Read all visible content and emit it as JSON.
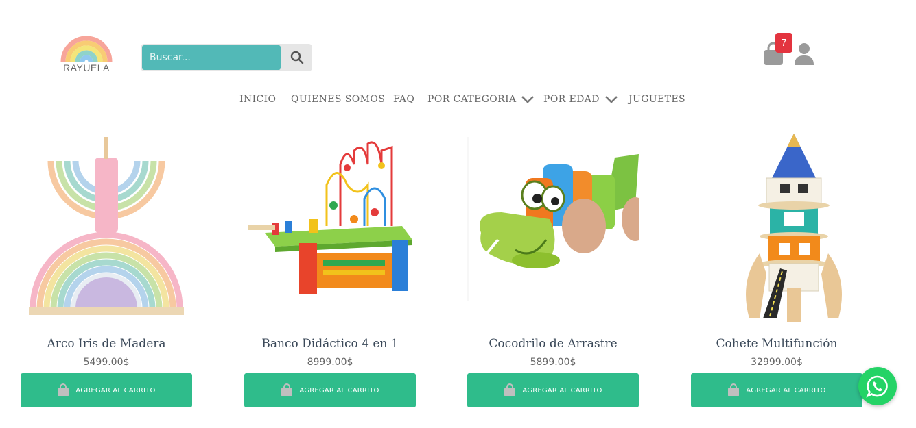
{
  "header": {
    "logo_text": "RAYUELA",
    "search": {
      "placeholder": "Buscar...",
      "value": ""
    },
    "cart_count": "7"
  },
  "nav": {
    "items": [
      "INICIO",
      "QUIENES SOMOS",
      "FAQ",
      "POR CATEGORIA",
      "POR EDAD",
      "JUGUETES"
    ]
  },
  "products": [
    {
      "name": "Arco Iris de Madera",
      "price": "5499.00$",
      "button_label": "AGREGAR AL CARRITO"
    },
    {
      "name": "Banco Didáctico 4 en 1",
      "price": "8999.00$",
      "button_label": "AGREGAR AL CARRITO"
    },
    {
      "name": "Cocodrilo de Arrastre",
      "price": "5899.00$",
      "button_label": "AGREGAR AL CARRITO"
    },
    {
      "name": "Cohete Multifunción",
      "price": "32999.00$",
      "button_label": "AGREGAR AL CARRITO"
    }
  ],
  "colors": {
    "search_bg": "#52b9b7",
    "button_green": "#2fbc8b",
    "badge_red": "#e3343f",
    "whatsapp_green": "#24d366"
  },
  "icons": {
    "search": "search-icon",
    "cart": "shopping-bag-icon",
    "user": "user-icon",
    "chevron": "chevron-down-icon",
    "whatsapp": "whatsapp-icon"
  }
}
